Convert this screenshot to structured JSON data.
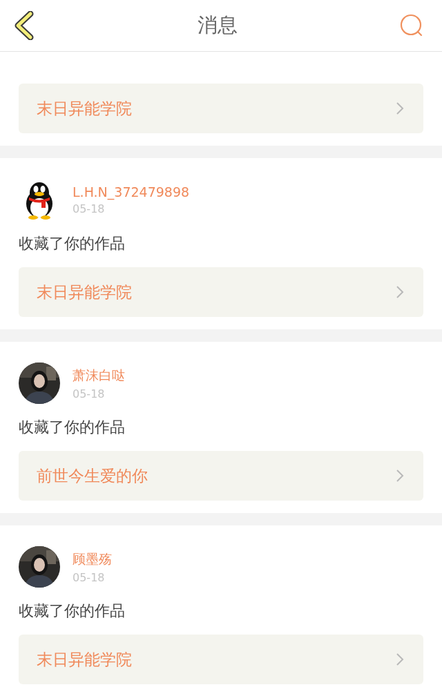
{
  "header": {
    "title": "消息"
  },
  "messages": [
    {
      "work": "末日异能学院"
    },
    {
      "avatar": {
        "kind": "penguin"
      },
      "user": "L.H.N_372479898",
      "date": "05-18",
      "action": "收藏了你的作品",
      "work": "末日异能学院"
    },
    {
      "user": "萧沫白哒",
      "date": "05-18",
      "action": "收藏了你的作品",
      "work": "前世今生爱的你"
    },
    {
      "user": "顾墨殇",
      "date": "05-18",
      "action": "收藏了你的作品",
      "work": "末日异能学院"
    }
  ]
}
